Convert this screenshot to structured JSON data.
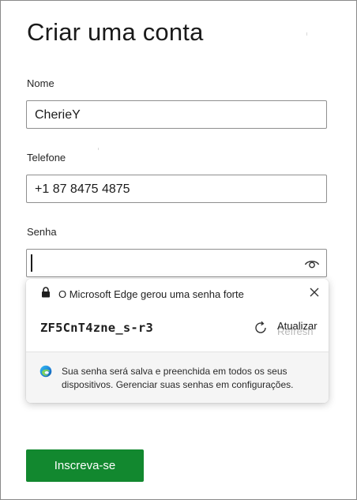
{
  "page": {
    "title": "Criar uma conta"
  },
  "form": {
    "name": {
      "label": "Nome",
      "value": "CherieY"
    },
    "phone": {
      "label": "Telefone",
      "value": "+1 87 8475 4875"
    },
    "password": {
      "label": "Senha",
      "value": ""
    },
    "submit_label": "Inscreva-se"
  },
  "suggestion_popup": {
    "title": "O Microsoft Edge gerou uma senha forte",
    "generated_password": "ZF5CnT4zne_s-r3",
    "refresh_label": "Atualizar",
    "refresh_ghost_label": "Refresh",
    "footer_text": "Sua senha será salva e preenchida em todos os seus dispositivos. Gerenciar suas senhas em configurações.",
    "icons": {
      "lock": "lock-icon",
      "close": "close-icon",
      "refresh": "refresh-icon",
      "edge": "edge-logo-icon",
      "reveal": "eye-icon"
    }
  },
  "colors": {
    "primary_button": "#12882f",
    "border": "#8f8f8f",
    "popup_footer_bg": "#f5f5f5"
  }
}
